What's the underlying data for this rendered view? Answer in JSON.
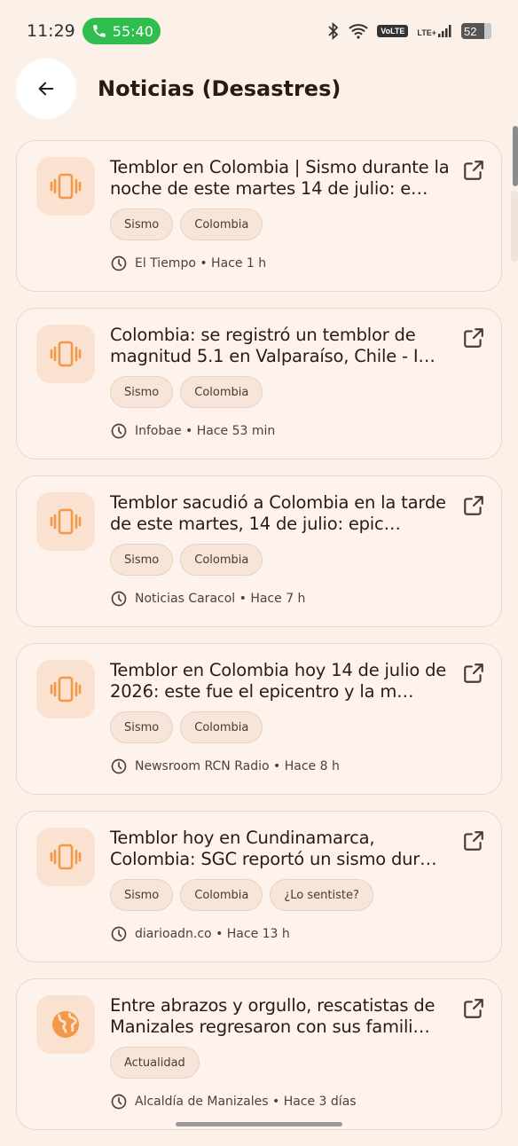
{
  "status_bar": {
    "time": "11:29",
    "call_timer": "55:40",
    "network": "VoLTE",
    "lte": "LTE+",
    "battery": "52"
  },
  "header": {
    "title": "Noticias (Desastres)"
  },
  "news": [
    {
      "icon": "vibration-icon",
      "title": "Temblor en Colombia | Sismo durante la noche de este martes 14 de julio: e…",
      "tags": [
        "Sismo",
        "Colombia"
      ],
      "meta": "El Tiempo • Hace 1 h"
    },
    {
      "icon": "vibration-icon",
      "title": "Colombia: se registró un temblor de magnitud 5.1 en Valparaíso, Chile - I…",
      "tags": [
        "Sismo",
        "Colombia"
      ],
      "meta": "Infobae • Hace 53 min"
    },
    {
      "icon": "vibration-icon",
      "title": "Temblor sacudió a Colombia en la tarde de este martes, 14 de julio: epic…",
      "tags": [
        "Sismo",
        "Colombia"
      ],
      "meta": "Noticias Caracol • Hace 7 h"
    },
    {
      "icon": "vibration-icon",
      "title": "Temblor en Colombia hoy 14 de julio de 2026: este fue el epicentro y la m…",
      "tags": [
        "Sismo",
        "Colombia"
      ],
      "meta": "Newsroom RCN Radio • Hace 8 h"
    },
    {
      "icon": "vibration-icon",
      "title": "Temblor hoy en Cundinamarca, Colombia: SGC reportó un sismo dur…",
      "tags": [
        "Sismo",
        "Colombia",
        "¿Lo sentiste?"
      ],
      "meta": "diarioadn.co • Hace 13 h"
    },
    {
      "icon": "globe-icon",
      "title": "Entre abrazos y orgullo, rescatistas de Manizales regresaron con sus famili…",
      "tags": [
        "Actualidad"
      ],
      "meta": "Alcaldía de Manizales • Hace 3 días"
    }
  ],
  "colors": {
    "background": "#fcf1e9",
    "accent": "#f2994a",
    "call_green": "#2fbd4e"
  }
}
